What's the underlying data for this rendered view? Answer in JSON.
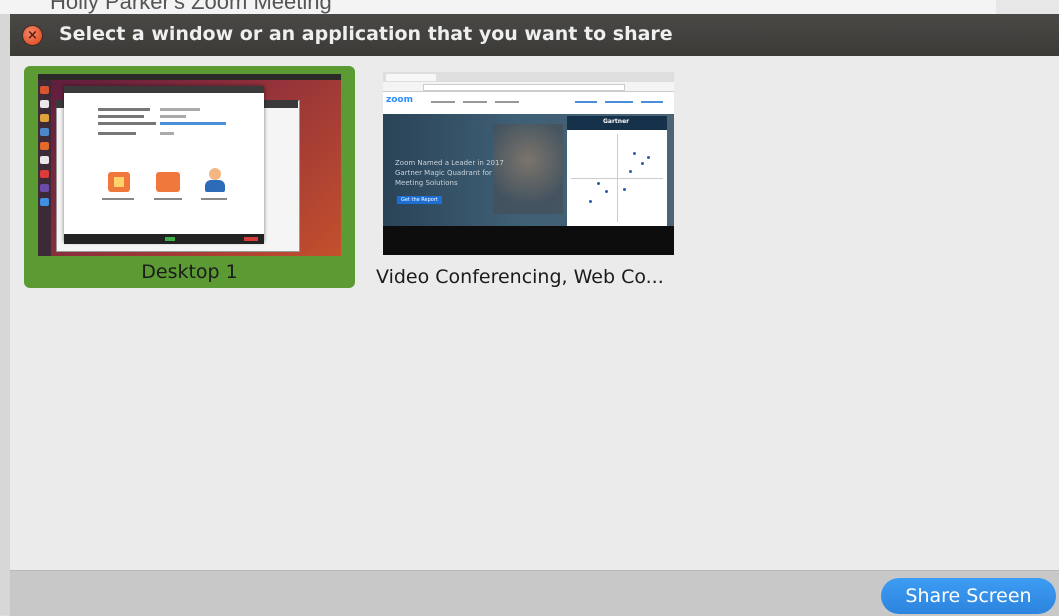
{
  "background_window": {
    "title": "Holly Parker's Zoom Meeting"
  },
  "dialog": {
    "title": "Select a window or an application that you want to share",
    "close_icon": "close-icon",
    "accent_color": "#5c9a34",
    "button_color": "#2c84df"
  },
  "tiles": [
    {
      "label": "Desktop 1",
      "selected": true
    },
    {
      "label": "Video Conferencing, Web Co...",
      "selected": false
    }
  ],
  "thumbnails": {
    "desktop": {
      "meeting_info": [
        "Meeting Topic",
        "Host",
        "Invitation URL",
        "Participant ID"
      ],
      "actions": [
        "Invite Others",
        "Share Screen",
        "Invite Others"
      ]
    },
    "video": {
      "brand": "zoom",
      "headline": "Zoom Named a Leader in 2017 Gartner Magic Quadrant for Meeting Solutions",
      "cta": "Get the Report",
      "panel_title": "Gartner"
    }
  },
  "footer": {
    "share_button_label": "Share Screen"
  }
}
